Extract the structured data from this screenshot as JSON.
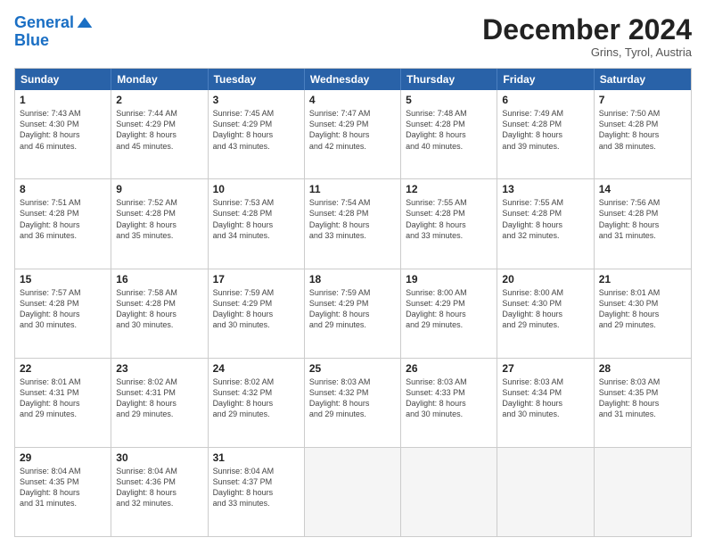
{
  "header": {
    "logo_line1": "General",
    "logo_line2": "Blue",
    "month": "December 2024",
    "location": "Grins, Tyrol, Austria"
  },
  "days_of_week": [
    "Sunday",
    "Monday",
    "Tuesday",
    "Wednesday",
    "Thursday",
    "Friday",
    "Saturday"
  ],
  "rows": [
    [
      {
        "day": "1",
        "lines": [
          "Sunrise: 7:43 AM",
          "Sunset: 4:30 PM",
          "Daylight: 8 hours",
          "and 46 minutes."
        ]
      },
      {
        "day": "2",
        "lines": [
          "Sunrise: 7:44 AM",
          "Sunset: 4:29 PM",
          "Daylight: 8 hours",
          "and 45 minutes."
        ]
      },
      {
        "day": "3",
        "lines": [
          "Sunrise: 7:45 AM",
          "Sunset: 4:29 PM",
          "Daylight: 8 hours",
          "and 43 minutes."
        ]
      },
      {
        "day": "4",
        "lines": [
          "Sunrise: 7:47 AM",
          "Sunset: 4:29 PM",
          "Daylight: 8 hours",
          "and 42 minutes."
        ]
      },
      {
        "day": "5",
        "lines": [
          "Sunrise: 7:48 AM",
          "Sunset: 4:28 PM",
          "Daylight: 8 hours",
          "and 40 minutes."
        ]
      },
      {
        "day": "6",
        "lines": [
          "Sunrise: 7:49 AM",
          "Sunset: 4:28 PM",
          "Daylight: 8 hours",
          "and 39 minutes."
        ]
      },
      {
        "day": "7",
        "lines": [
          "Sunrise: 7:50 AM",
          "Sunset: 4:28 PM",
          "Daylight: 8 hours",
          "and 38 minutes."
        ]
      }
    ],
    [
      {
        "day": "8",
        "lines": [
          "Sunrise: 7:51 AM",
          "Sunset: 4:28 PM",
          "Daylight: 8 hours",
          "and 36 minutes."
        ]
      },
      {
        "day": "9",
        "lines": [
          "Sunrise: 7:52 AM",
          "Sunset: 4:28 PM",
          "Daylight: 8 hours",
          "and 35 minutes."
        ]
      },
      {
        "day": "10",
        "lines": [
          "Sunrise: 7:53 AM",
          "Sunset: 4:28 PM",
          "Daylight: 8 hours",
          "and 34 minutes."
        ]
      },
      {
        "day": "11",
        "lines": [
          "Sunrise: 7:54 AM",
          "Sunset: 4:28 PM",
          "Daylight: 8 hours",
          "and 33 minutes."
        ]
      },
      {
        "day": "12",
        "lines": [
          "Sunrise: 7:55 AM",
          "Sunset: 4:28 PM",
          "Daylight: 8 hours",
          "and 33 minutes."
        ]
      },
      {
        "day": "13",
        "lines": [
          "Sunrise: 7:55 AM",
          "Sunset: 4:28 PM",
          "Daylight: 8 hours",
          "and 32 minutes."
        ]
      },
      {
        "day": "14",
        "lines": [
          "Sunrise: 7:56 AM",
          "Sunset: 4:28 PM",
          "Daylight: 8 hours",
          "and 31 minutes."
        ]
      }
    ],
    [
      {
        "day": "15",
        "lines": [
          "Sunrise: 7:57 AM",
          "Sunset: 4:28 PM",
          "Daylight: 8 hours",
          "and 30 minutes."
        ]
      },
      {
        "day": "16",
        "lines": [
          "Sunrise: 7:58 AM",
          "Sunset: 4:28 PM",
          "Daylight: 8 hours",
          "and 30 minutes."
        ]
      },
      {
        "day": "17",
        "lines": [
          "Sunrise: 7:59 AM",
          "Sunset: 4:29 PM",
          "Daylight: 8 hours",
          "and 30 minutes."
        ]
      },
      {
        "day": "18",
        "lines": [
          "Sunrise: 7:59 AM",
          "Sunset: 4:29 PM",
          "Daylight: 8 hours",
          "and 29 minutes."
        ]
      },
      {
        "day": "19",
        "lines": [
          "Sunrise: 8:00 AM",
          "Sunset: 4:29 PM",
          "Daylight: 8 hours",
          "and 29 minutes."
        ]
      },
      {
        "day": "20",
        "lines": [
          "Sunrise: 8:00 AM",
          "Sunset: 4:30 PM",
          "Daylight: 8 hours",
          "and 29 minutes."
        ]
      },
      {
        "day": "21",
        "lines": [
          "Sunrise: 8:01 AM",
          "Sunset: 4:30 PM",
          "Daylight: 8 hours",
          "and 29 minutes."
        ]
      }
    ],
    [
      {
        "day": "22",
        "lines": [
          "Sunrise: 8:01 AM",
          "Sunset: 4:31 PM",
          "Daylight: 8 hours",
          "and 29 minutes."
        ]
      },
      {
        "day": "23",
        "lines": [
          "Sunrise: 8:02 AM",
          "Sunset: 4:31 PM",
          "Daylight: 8 hours",
          "and 29 minutes."
        ]
      },
      {
        "day": "24",
        "lines": [
          "Sunrise: 8:02 AM",
          "Sunset: 4:32 PM",
          "Daylight: 8 hours",
          "and 29 minutes."
        ]
      },
      {
        "day": "25",
        "lines": [
          "Sunrise: 8:03 AM",
          "Sunset: 4:32 PM",
          "Daylight: 8 hours",
          "and 29 minutes."
        ]
      },
      {
        "day": "26",
        "lines": [
          "Sunrise: 8:03 AM",
          "Sunset: 4:33 PM",
          "Daylight: 8 hours",
          "and 30 minutes."
        ]
      },
      {
        "day": "27",
        "lines": [
          "Sunrise: 8:03 AM",
          "Sunset: 4:34 PM",
          "Daylight: 8 hours",
          "and 30 minutes."
        ]
      },
      {
        "day": "28",
        "lines": [
          "Sunrise: 8:03 AM",
          "Sunset: 4:35 PM",
          "Daylight: 8 hours",
          "and 31 minutes."
        ]
      }
    ],
    [
      {
        "day": "29",
        "lines": [
          "Sunrise: 8:04 AM",
          "Sunset: 4:35 PM",
          "Daylight: 8 hours",
          "and 31 minutes."
        ]
      },
      {
        "day": "30",
        "lines": [
          "Sunrise: 8:04 AM",
          "Sunset: 4:36 PM",
          "Daylight: 8 hours",
          "and 32 minutes."
        ]
      },
      {
        "day": "31",
        "lines": [
          "Sunrise: 8:04 AM",
          "Sunset: 4:37 PM",
          "Daylight: 8 hours",
          "and 33 minutes."
        ]
      },
      {
        "day": "",
        "lines": []
      },
      {
        "day": "",
        "lines": []
      },
      {
        "day": "",
        "lines": []
      },
      {
        "day": "",
        "lines": []
      }
    ]
  ]
}
